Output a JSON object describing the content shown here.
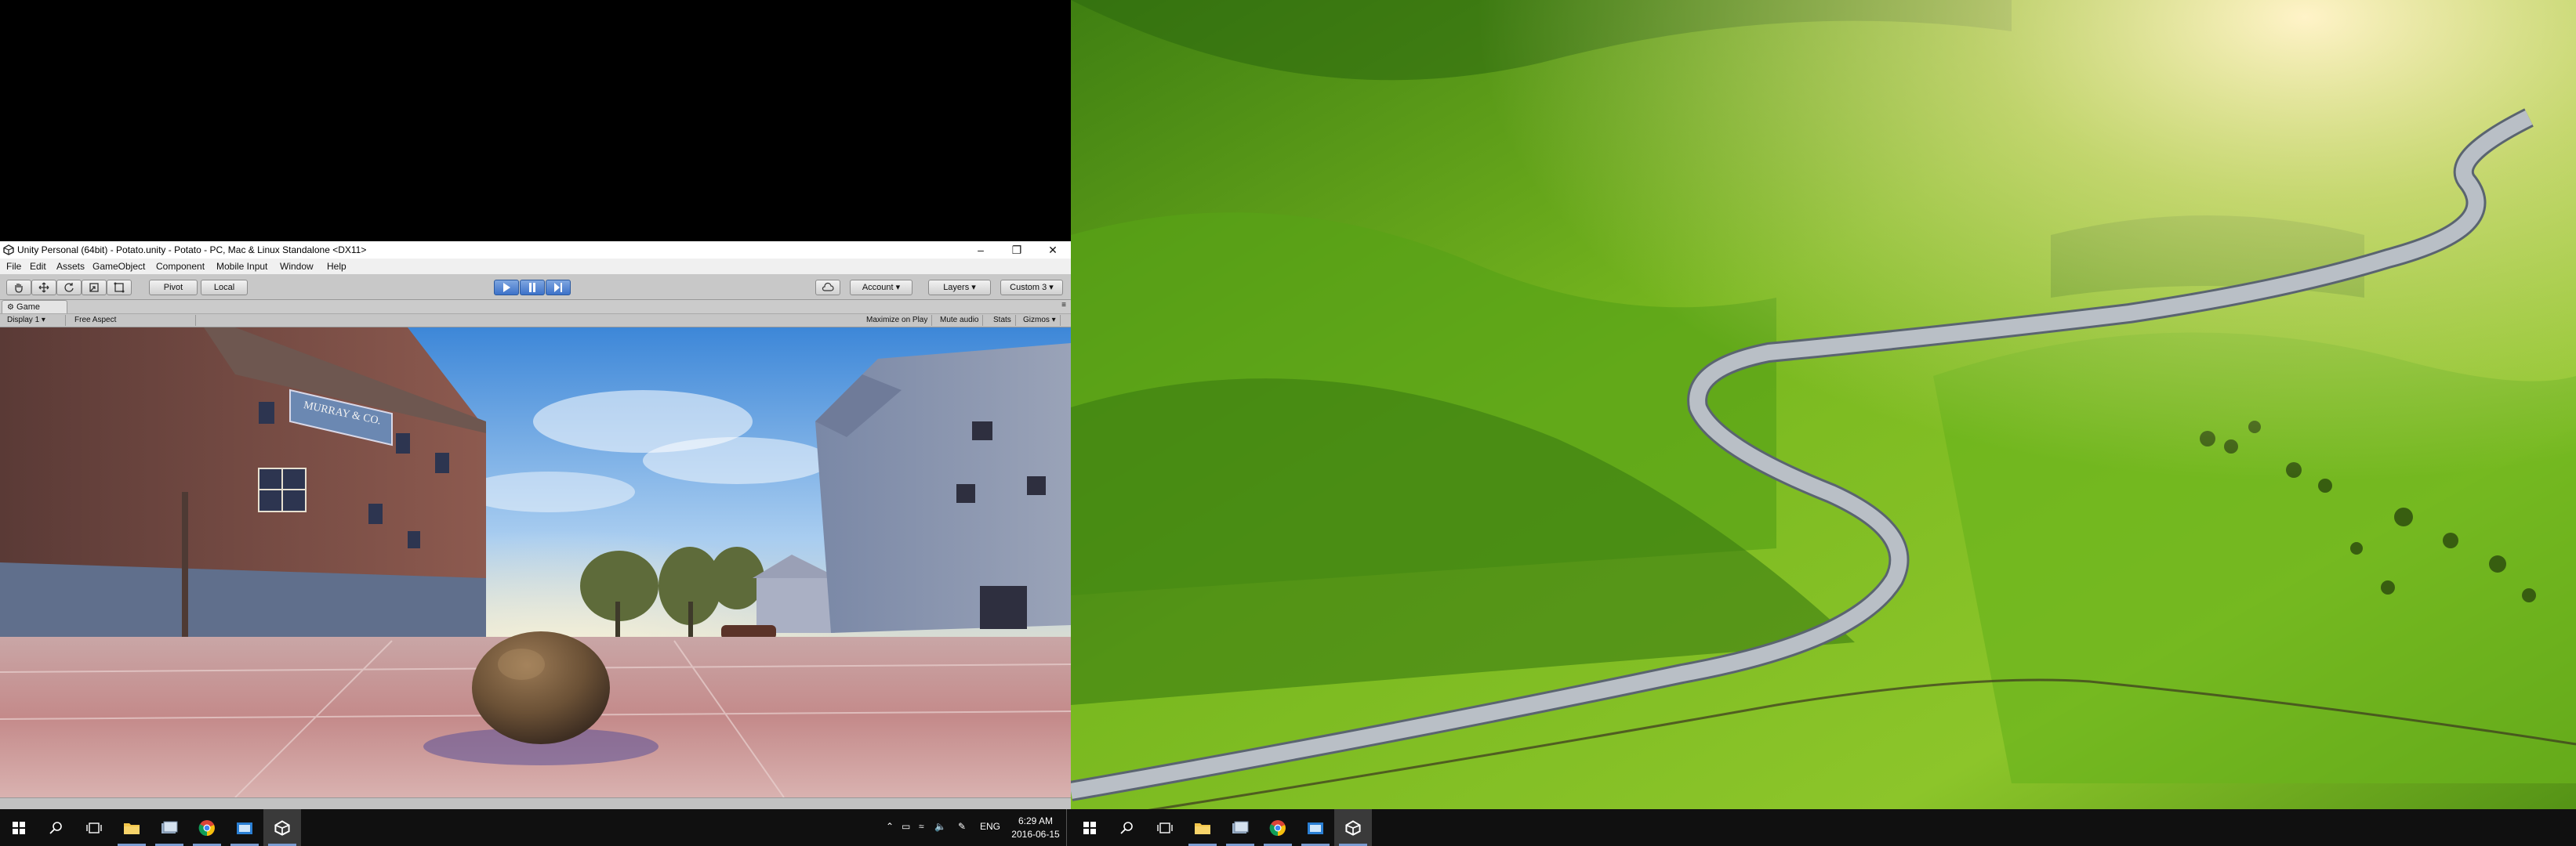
{
  "unity": {
    "title": "Unity Personal (64bit) - Potato.unity - Potato - PC, Mac & Linux Standalone <DX11>",
    "menu": [
      "File",
      "Edit",
      "Assets",
      "GameObject",
      "Component",
      "Mobile Input",
      "Window",
      "Help"
    ],
    "toolbar": {
      "pivot": "Pivot",
      "local": "Local",
      "account": "Account",
      "layers": "Layers",
      "layout": "Custom 3"
    },
    "game_tab": "Game",
    "display": "Display 1",
    "aspect": "Free Aspect",
    "maximize_on_play": "Maximize on Play",
    "mute_audio": "Mute audio",
    "stats": "Stats",
    "gizmos": "Gizmos",
    "scene": {
      "sign_text": "MURRAY & CO."
    }
  },
  "taskbar_left": {
    "tray": {
      "language": "ENG",
      "time": "6:29 AM",
      "date": "2016-06-15"
    }
  },
  "taskbar_icons": [
    "start-icon",
    "search-icon",
    "task-view-icon",
    "file-explorer-icon",
    "app-icon",
    "chrome-icon",
    "app-icon",
    "unity-icon"
  ],
  "colors": {
    "taskbar": "#101010",
    "play_button_active": "#3d72c9",
    "grass": "#6fb21a",
    "sky_left": "#7fb6e8"
  }
}
